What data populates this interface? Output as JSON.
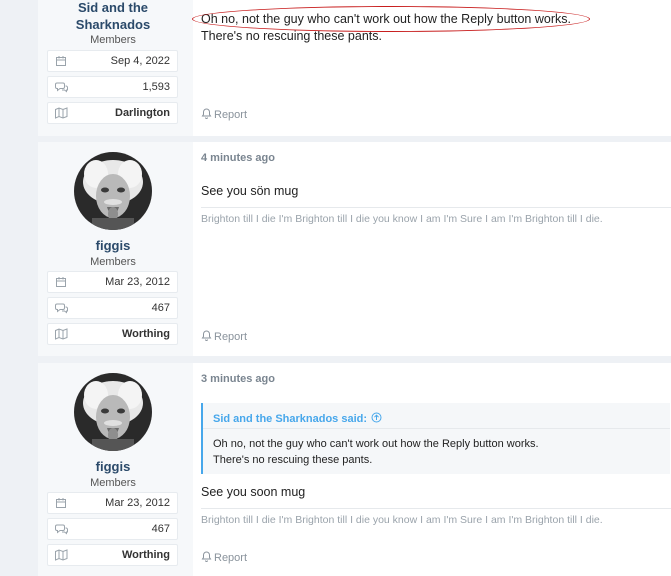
{
  "posts": [
    {
      "user": {
        "name": "Sid and the Sharknados",
        "title": "Members"
      },
      "stats": {
        "joined": "Sep 4, 2022",
        "messages": "1,593",
        "location": "Darlington"
      },
      "lines": [
        "Oh no, not the guy who can't work out how the Reply button works.",
        "There's no rescuing these pants."
      ],
      "report_label": "Report"
    },
    {
      "user": {
        "name": "figgis",
        "title": "Members"
      },
      "stats": {
        "joined": "Mar 23, 2012",
        "messages": "467",
        "location": "Worthing"
      },
      "time": "4 minutes ago",
      "message": "See you sön mug",
      "signature": "Brighton till I die I'm Brighton till I die you know I am I'm Sure I am I'm Brighton till I die.",
      "report_label": "Report"
    },
    {
      "user": {
        "name": "figgis",
        "title": "Members"
      },
      "stats": {
        "joined": "Mar 23, 2012",
        "messages": "467",
        "location": "Worthing"
      },
      "time": "3 minutes ago",
      "quote": {
        "author": "Sid and the Sharknados said:",
        "lines": [
          "Oh no, not the guy who can't work out how the Reply button works.",
          "There's no rescuing these pants."
        ]
      },
      "message": "See you soon mug",
      "signature": "Brighton till I die I'm Brighton till I die you know I am I'm Sure I am I'm Brighton till I die.",
      "report_label": "Report"
    }
  ],
  "icons": {
    "joined": "calendar-icon",
    "messages": "speech-bubbles-icon",
    "location": "map-icon",
    "report": "bell-icon",
    "quote_link": "arrow-up-circle-icon"
  },
  "colors": {
    "quote_accent": "#47a7eb",
    "annotation": "#c81e1e",
    "username": "#2b4a6a"
  }
}
